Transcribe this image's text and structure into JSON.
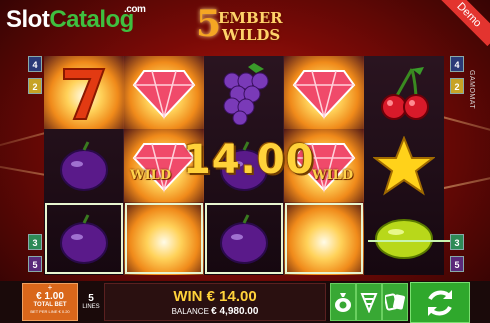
{
  "brand": {
    "logo_main": "Slot",
    "logo_accent": "Catalog",
    "logo_suffix": ".com"
  },
  "game_title": {
    "number": "5",
    "line1": "EMBER",
    "line2": "WILDS"
  },
  "badge": {
    "demo": "Demo"
  },
  "provider": "GAMOMAT",
  "side_buttons": {
    "left": [
      "4",
      "2",
      "3",
      "5"
    ],
    "right": [
      "4",
      "2",
      "3",
      "5"
    ]
  },
  "reels": [
    [
      "seven",
      "plum",
      "plum"
    ],
    [
      "diamond",
      "diamond-wild",
      "flame"
    ],
    [
      "grapes",
      "plum",
      "plum"
    ],
    [
      "diamond",
      "diamond-wild",
      "flame"
    ],
    [
      "cherries",
      "star",
      "lemon"
    ]
  ],
  "wild_labels": [
    "WILD",
    "WILD"
  ],
  "win_display": "14.00",
  "bottom_bar": {
    "bet_plus": "+",
    "bet_amount": "€ 1.00",
    "bet_label": "TOTAL BET",
    "bet_sub": "BET PER LINE € 0.20",
    "lines_count": "5",
    "lines_label": "LINES",
    "win_text": "WIN € 14.00",
    "balance_label": "BALANCE",
    "balance_value": "€ 4,980.00"
  },
  "colors": {
    "accent": "#f5a623",
    "spin": "#2fa82c",
    "bet": "#d9671b"
  }
}
